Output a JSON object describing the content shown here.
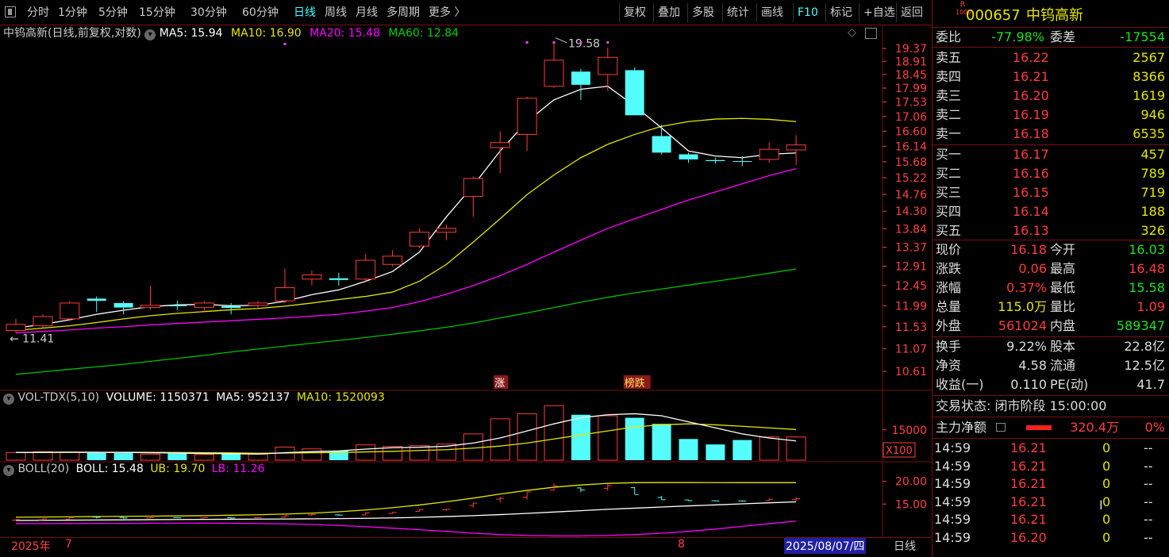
{
  "toolbar": {
    "left_items": [
      "分时",
      "1分钟",
      "5分钟",
      "15分钟",
      "30分钟",
      "60分钟",
      "日线",
      "周线",
      "月线",
      "多周期",
      "更多 〉"
    ],
    "active_index": 6,
    "right_items": [
      "复权",
      "叠加",
      "多股",
      "统计",
      "画线",
      "F10",
      "标记",
      "+自选",
      "返回"
    ]
  },
  "stock": {
    "badge_top": "R",
    "badge_bottom": "1000",
    "code": "000657",
    "name": "中钨高新"
  },
  "main_chart": {
    "title": "中钨高新(日线,前复权,对数)",
    "ma5": "MA5: 15.94",
    "ma10": "MA10: 16.90",
    "ma20": "MA20: 15.48",
    "ma60": "MA60: 12.84",
    "high_label": "19.58",
    "low_label": "11.41",
    "tag_zhang": "涨",
    "tag_bang": "榜跌",
    "price_axis": [
      "19.37",
      "18.91",
      "18.45",
      "17.99",
      "17.53",
      "17.06",
      "16.60",
      "16.14",
      "15.68",
      "15.22",
      "14.76",
      "14.30",
      "13.84",
      "13.37",
      "12.91",
      "12.45",
      "11.99",
      "11.53",
      "11.07",
      "10.61"
    ]
  },
  "volume_chart": {
    "title": "VOL-TDX(5,10)",
    "volume": "VOLUME: 1150371",
    "ma5": "MA5: 952137",
    "ma10": "MA10: 1520093",
    "axis_value": "15000",
    "unit": "X100"
  },
  "boll_chart": {
    "title": "BOLL(20)",
    "boll": "BOLL: 15.48",
    "ub": "UB: 19.70",
    "lb": "LB: 11.26",
    "axis": [
      "20.00",
      "15.00"
    ]
  },
  "date_axis": {
    "year": "2025年",
    "month7": "7",
    "month8": "8",
    "current_date": "2025/08/07/四",
    "period": "日线"
  },
  "quote": {
    "weibi_label": "委比",
    "weibi_value": "-77.98%",
    "weicha_label": "委差",
    "weicha_value": "-17554",
    "sell": [
      {
        "label": "卖五",
        "price": "16.22",
        "vol": "2567"
      },
      {
        "label": "卖四",
        "price": "16.21",
        "vol": "8366"
      },
      {
        "label": "卖三",
        "price": "16.20",
        "vol": "1619"
      },
      {
        "label": "卖二",
        "price": "16.19",
        "vol": "946"
      },
      {
        "label": "卖一",
        "price": "16.18",
        "vol": "6535"
      }
    ],
    "buy": [
      {
        "label": "买一",
        "price": "16.17",
        "vol": "457"
      },
      {
        "label": "买二",
        "price": "16.16",
        "vol": "789"
      },
      {
        "label": "买三",
        "price": "16.15",
        "vol": "719"
      },
      {
        "label": "买四",
        "price": "16.14",
        "vol": "188"
      },
      {
        "label": "买五",
        "price": "16.13",
        "vol": "326"
      }
    ],
    "stats": [
      {
        "l1": "现价",
        "v1": "16.18",
        "c1": "red",
        "l2": "今开",
        "v2": "16.03",
        "c2": "green"
      },
      {
        "l1": "涨跌",
        "v1": "0.06",
        "c1": "red",
        "l2": "最高",
        "v2": "16.48",
        "c2": "red"
      },
      {
        "l1": "涨幅",
        "v1": "0.37%",
        "c1": "red",
        "l2": "最低",
        "v2": "15.58",
        "c2": "green"
      },
      {
        "l1": "总量",
        "v1": "115.0万",
        "c1": "yellow",
        "l2": "量比",
        "v2": "1.09",
        "c2": "red"
      },
      {
        "l1": "外盘",
        "v1": "561024",
        "c1": "red",
        "l2": "内盘",
        "v2": "589347",
        "c2": "green"
      }
    ],
    "stats2": [
      {
        "l1": "换手",
        "v1": "9.22%",
        "l2": "股本",
        "v2": "22.8亿"
      },
      {
        "l1": "净资",
        "v1": "4.58",
        "l2": "流通",
        "v2": "12.5亿"
      },
      {
        "l1": "收益(一)",
        "v1": "0.110",
        "l2": "PE(动)",
        "v2": "41.7"
      }
    ],
    "trade_state": "交易状态: 闭市阶段 15:00:00",
    "main_flow_label": "主力净额",
    "main_flow_value": "320.4万",
    "main_flow_pct": "0%",
    "ticks": [
      {
        "t": "14:59",
        "p": "16.21",
        "v": "0",
        "d": "--"
      },
      {
        "t": "14:59",
        "p": "16.21",
        "v": "0",
        "d": "--"
      },
      {
        "t": "14:59",
        "p": "16.21",
        "v": "0",
        "d": "--"
      },
      {
        "t": "14:59",
        "p": "16.21",
        "v": "0",
        "d": "--"
      },
      {
        "t": "14:59",
        "p": "16.21",
        "v": "0",
        "d": "--"
      },
      {
        "t": "14:59",
        "p": "16.20",
        "v": "0",
        "d": "--"
      }
    ]
  },
  "colors": {
    "up": "#ff3c3c",
    "down": "#54fcfc",
    "ma5": "#ffffff",
    "ma10": "#e6e600",
    "ma20": "#ff00ff",
    "ma60": "#00c000",
    "border": "#7a1010"
  },
  "chart_data": {
    "type": "candlestick",
    "candles": [
      {
        "o": 11.45,
        "h": 11.7,
        "l": 11.4,
        "c": 11.58
      },
      {
        "o": 11.55,
        "h": 11.8,
        "l": 11.5,
        "c": 11.75
      },
      {
        "o": 11.7,
        "h": 12.1,
        "l": 11.65,
        "c": 12.05
      },
      {
        "o": 12.15,
        "h": 12.2,
        "l": 11.85,
        "c": 12.1
      },
      {
        "o": 12.05,
        "h": 12.1,
        "l": 11.8,
        "c": 11.95
      },
      {
        "o": 11.95,
        "h": 12.45,
        "l": 11.9,
        "c": 12.0
      },
      {
        "o": 12.0,
        "h": 12.1,
        "l": 11.9,
        "c": 11.98
      },
      {
        "o": 11.95,
        "h": 12.1,
        "l": 11.85,
        "c": 12.05
      },
      {
        "o": 11.98,
        "h": 12.05,
        "l": 11.8,
        "c": 11.94
      },
      {
        "o": 12.0,
        "h": 12.1,
        "l": 11.95,
        "c": 12.05
      },
      {
        "o": 12.1,
        "h": 12.85,
        "l": 12.05,
        "c": 12.4
      },
      {
        "o": 12.6,
        "h": 12.8,
        "l": 12.45,
        "c": 12.7
      },
      {
        "o": 12.62,
        "h": 12.75,
        "l": 12.45,
        "c": 12.58
      },
      {
        "o": 12.6,
        "h": 13.2,
        "l": 12.55,
        "c": 13.05
      },
      {
        "o": 12.95,
        "h": 13.3,
        "l": 12.9,
        "c": 13.15
      },
      {
        "o": 13.4,
        "h": 13.85,
        "l": 13.35,
        "c": 13.75
      },
      {
        "o": 13.75,
        "h": 13.95,
        "l": 13.55,
        "c": 13.85
      },
      {
        "o": 14.7,
        "h": 15.25,
        "l": 14.15,
        "c": 15.2
      },
      {
        "o": 16.1,
        "h": 16.6,
        "l": 15.35,
        "c": 16.25
      },
      {
        "o": 16.5,
        "h": 17.7,
        "l": 16.0,
        "c": 17.65
      },
      {
        "o": 18.05,
        "h": 19.58,
        "l": 18.0,
        "c": 18.95
      },
      {
        "o": 18.55,
        "h": 18.65,
        "l": 17.6,
        "c": 18.1
      },
      {
        "o": 18.45,
        "h": 19.4,
        "l": 17.9,
        "c": 19.05
      },
      {
        "o": 18.6,
        "h": 18.7,
        "l": 17.1,
        "c": 17.1
      },
      {
        "o": 16.45,
        "h": 16.8,
        "l": 15.9,
        "c": 15.95
      },
      {
        "o": 15.9,
        "h": 15.95,
        "l": 15.65,
        "c": 15.75
      },
      {
        "o": 15.73,
        "h": 15.8,
        "l": 15.62,
        "c": 15.7
      },
      {
        "o": 15.7,
        "h": 15.85,
        "l": 15.55,
        "c": 15.68
      },
      {
        "o": 15.75,
        "h": 16.25,
        "l": 15.65,
        "c": 16.05
      },
      {
        "o": 16.03,
        "h": 16.48,
        "l": 15.58,
        "c": 16.18
      }
    ],
    "ma5": [
      11.5,
      11.58,
      11.68,
      11.8,
      11.89,
      11.97,
      12.01,
      12.02,
      11.99,
      12.0,
      12.09,
      12.24,
      12.35,
      12.55,
      12.78,
      13.25,
      14.15,
      15.0,
      16.0,
      16.9,
      17.6,
      17.95,
      18.05,
      17.4,
      16.7,
      16.0,
      15.85,
      15.8,
      15.9,
      15.94
    ],
    "ma10": [
      11.45,
      11.5,
      11.55,
      11.62,
      11.7,
      11.77,
      11.82,
      11.86,
      11.9,
      11.93,
      11.98,
      12.05,
      12.13,
      12.2,
      12.3,
      12.55,
      12.95,
      13.5,
      14.1,
      14.75,
      15.3,
      15.8,
      16.2,
      16.5,
      16.75,
      16.9,
      16.98,
      17.0,
      16.97,
      16.9
    ],
    "ma20": [
      11.4,
      11.43,
      11.46,
      11.5,
      11.53,
      11.57,
      11.6,
      11.63,
      11.66,
      11.69,
      11.72,
      11.76,
      11.8,
      11.87,
      11.95,
      12.08,
      12.25,
      12.45,
      12.68,
      12.95,
      13.25,
      13.55,
      13.85,
      14.1,
      14.35,
      14.6,
      14.82,
      15.05,
      15.28,
      15.48
    ],
    "ma60": [
      10.55,
      10.6,
      10.65,
      10.7,
      10.75,
      10.81,
      10.87,
      10.93,
      11.0,
      11.06,
      11.12,
      11.18,
      11.24,
      11.3,
      11.37,
      11.44,
      11.52,
      11.61,
      11.72,
      11.83,
      11.95,
      12.07,
      12.18,
      12.28,
      12.37,
      12.46,
      12.55,
      12.64,
      12.74,
      12.84
    ],
    "volume": [
      380000,
      420000,
      400000,
      360000,
      350000,
      300000,
      330000,
      280000,
      310000,
      300000,
      650000,
      560000,
      470000,
      760000,
      680000,
      720000,
      800000,
      1300000,
      2050000,
      2300000,
      2700000,
      2250000,
      2200000,
      2100000,
      1800000,
      1050000,
      780000,
      1000000,
      1150000,
      1150371
    ],
    "vol_ma5": [
      380000,
      390000,
      395000,
      390000,
      385000,
      370000,
      355000,
      330000,
      320000,
      305000,
      370000,
      425000,
      460000,
      550000,
      620000,
      640000,
      690000,
      850000,
      1100000,
      1450000,
      1800000,
      2100000,
      2250000,
      2300000,
      2200000,
      1900000,
      1600000,
      1300000,
      1100000,
      952137
    ],
    "vol_ma10": [
      380000,
      385000,
      390000,
      390000,
      390000,
      385000,
      380000,
      370000,
      360000,
      345000,
      355000,
      370000,
      380000,
      410000,
      440000,
      480000,
      520000,
      600000,
      700000,
      850000,
      1050000,
      1250000,
      1450000,
      1650000,
      1750000,
      1800000,
      1750000,
      1680000,
      1600000,
      1520093
    ],
    "boll_mid": [
      11.4,
      11.43,
      11.46,
      11.5,
      11.53,
      11.57,
      11.6,
      11.63,
      11.66,
      11.69,
      11.72,
      11.76,
      11.8,
      11.87,
      11.95,
      12.08,
      12.25,
      12.45,
      12.68,
      12.95,
      13.25,
      13.55,
      13.85,
      14.1,
      14.35,
      14.6,
      14.82,
      15.05,
      15.28,
      15.48
    ],
    "boll_ub": [
      12.1,
      12.15,
      12.2,
      12.25,
      12.3,
      12.35,
      12.4,
      12.45,
      12.55,
      12.65,
      12.8,
      13.0,
      13.3,
      13.7,
      14.2,
      14.8,
      15.5,
      16.3,
      17.2,
      18.0,
      18.7,
      19.2,
      19.55,
      19.7,
      19.72,
      19.72,
      19.71,
      19.7,
      19.7,
      19.7
    ],
    "boll_lb": [
      10.7,
      10.71,
      10.72,
      10.75,
      10.76,
      10.79,
      10.8,
      10.81,
      10.77,
      10.73,
      10.64,
      10.52,
      10.3,
      10.04,
      9.7,
      9.36,
      9.0,
      8.6,
      8.3,
      8.1,
      8.0,
      8.0,
      8.1,
      8.3,
      8.6,
      9.0,
      9.5,
      10.1,
      10.7,
      11.26
    ]
  }
}
